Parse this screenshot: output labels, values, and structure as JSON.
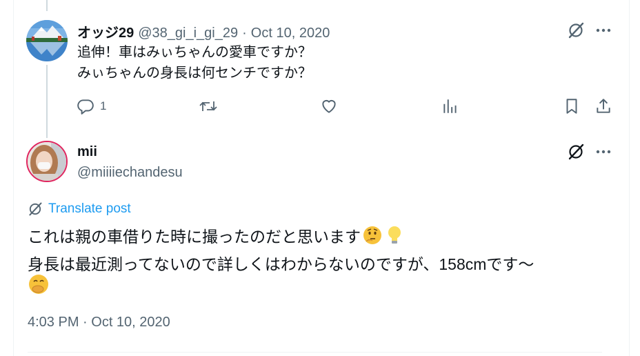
{
  "reply_tweet": {
    "display_name": "オッジ29",
    "handle": "@38_gi_i_gi_29",
    "separator": "·",
    "date": "Oct 10, 2020",
    "lines": [
      "追伸！車はみぃちゃんの愛車ですか？",
      "みぃちゃんの身長は何センチですか？"
    ],
    "actions": {
      "reply_count": "1",
      "retweet_count": "",
      "like_count": "",
      "views_count": ""
    }
  },
  "main_tweet": {
    "display_name": "mii",
    "handle": "@miiiiechandesu",
    "translate_label": "Translate post",
    "lines": [
      "これは親の車借りた時に撮ったのだと思います",
      "身長は最近測ってないので詳しくはわからないのですが、158cmです〜"
    ],
    "emojis": [
      "thinking-face",
      "light-bulb",
      "hand-over-mouth"
    ],
    "timestamp": "4:03 PM · Oct 10, 2020"
  },
  "colors": {
    "text_primary": "#0f1419",
    "text_secondary": "#536471",
    "link_blue": "#1d9bf0",
    "border": "#eff3f4",
    "thread_line": "#cfd9de"
  }
}
